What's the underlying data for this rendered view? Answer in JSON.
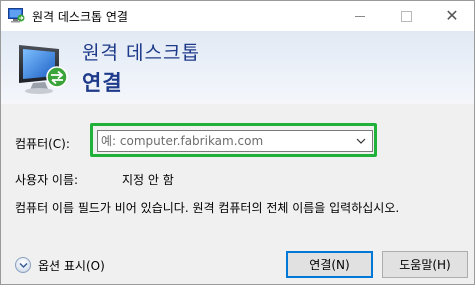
{
  "window": {
    "title": "원격 데스크톱 연결"
  },
  "banner": {
    "line1": "원격 데스크톱",
    "line2": "연결"
  },
  "form": {
    "computer_label": "컴퓨터(C):",
    "computer_placeholder": "예: computer.fabrikam.com",
    "username_label": "사용자 이름:",
    "username_value": "지정 안 함",
    "help_text": "컴퓨터 이름 필드가 비어 있습니다. 원격 컴퓨터의 전체 이름을 입력하십시오."
  },
  "footer": {
    "options_label": "옵션 표시(O)",
    "connect_label": "연결(N)",
    "help_label": "도움말(H)"
  },
  "colors": {
    "highlight": "#1fb13a",
    "banner_text": "#1e3a8a",
    "default_button_border": "#0078d7"
  },
  "icons": {
    "title": "remote-desktop-icon",
    "banner": "remote-desktop-monitor-icon",
    "combo": "chevron-down-icon",
    "options": "expand-down-icon"
  }
}
